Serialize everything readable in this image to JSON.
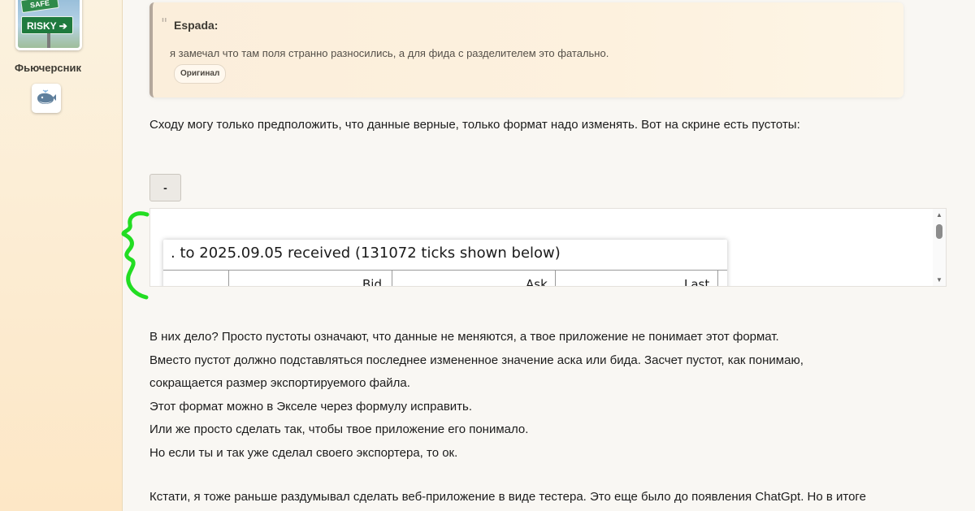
{
  "sidebar": {
    "avatar_signs": {
      "safe": "SAFE",
      "risky": "RISKY ➔"
    },
    "username": "Фьючерсник",
    "badge_icon": "whale-icon"
  },
  "quote": {
    "author": "Espada:",
    "text": "я замечал что там поля странно разносились, а для фида с разделителем это фатально.",
    "original_label": "Оригинал"
  },
  "post": {
    "intro": "Сходу могу только предположить, что данные верные, только формат надо изменять. Вот на скрине есть пустоты:",
    "spoiler_label": "-",
    "lines": [
      "В них дело? Просто пустоты означают, что данные не меняются, а твое приложение не понимает этот формат.",
      "Вместо пустот должно подставляться последнее измененное значение аска или бида. Засчет пустот, как понимаю,",
      "сокращается размер экспортируемого файла.",
      "Этот формат можно в Экселе через формулу исправить.",
      "Или же просто сделать так, чтобы твое приложение его понимало.",
      "Но если ты и так уже сделал своего экспортера, то ок."
    ],
    "last_line": "Кстати, я тоже раньше раздумывал сделать веб-приложение в виде тестера. Это еще было до появления ChatGpt. Но в итоге"
  },
  "embed": {
    "title": ". to 2025.09.05 received (131072 ticks shown below)",
    "columns": [
      "Bid",
      "Ask",
      "Last"
    ]
  },
  "colors": {
    "annotation": "#22dd22",
    "quote_border": "#b3a79c"
  }
}
